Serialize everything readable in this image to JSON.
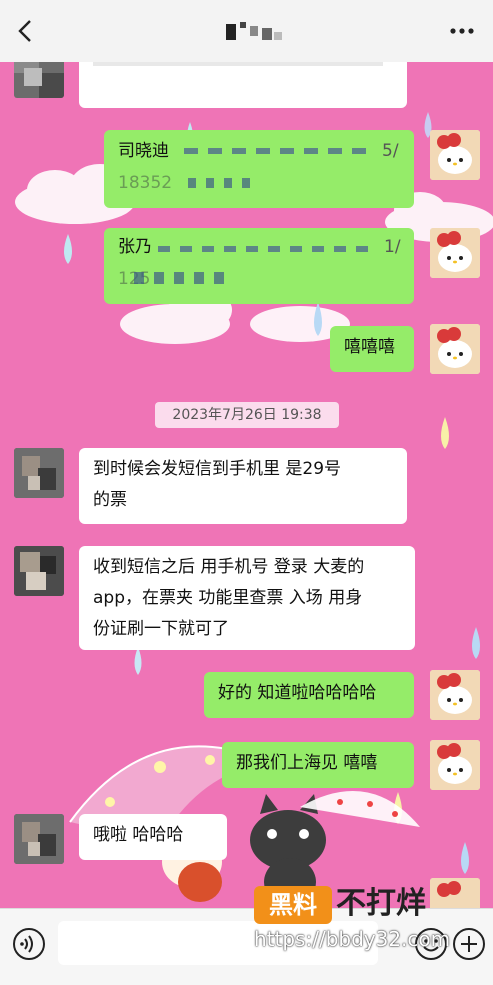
{
  "header": {
    "back_icon": "chevron-left-icon",
    "title": "",
    "more_icon": "more-dots-icon"
  },
  "messages": [
    {
      "side": "out",
      "prefix": "司晓迪",
      "partial": "18352",
      "suffix": "5/"
    },
    {
      "side": "out",
      "prefix": "张乃",
      "partial": "125",
      "suffix": "1/"
    },
    {
      "side": "out",
      "text": "嘻嘻嘻"
    },
    {
      "side": "in",
      "lines": [
        "到时候会发短信到手机里   是29号",
        "的票"
      ]
    },
    {
      "side": "in",
      "lines": [
        "收到短信之后 用手机号 登录 大麦的",
        "app，在票夹 功能里查票 入场 用身",
        "份证刷一下就可了"
      ]
    },
    {
      "side": "out",
      "text": "好的 知道啦哈哈哈哈"
    },
    {
      "side": "out",
      "text": "那我们上海见 嘻嘻"
    },
    {
      "side": "in",
      "text": "哦啦  哈哈哈"
    }
  ],
  "timestamp": "2023年7月26日 19:38",
  "bottombar": {
    "voice_icon": "voice-icon",
    "emoji_icon": "emoji-icon",
    "plus_icon": "plus-icon"
  },
  "watermark": {
    "logo_text": "黑料",
    "brand": "不打烊",
    "url": "https://bbdy32.com"
  },
  "colors": {
    "background": "#ef74b6",
    "outgoing_bubble": "#95ec69",
    "incoming_bubble": "#ffffff",
    "watermark_orange": "#f29019"
  }
}
